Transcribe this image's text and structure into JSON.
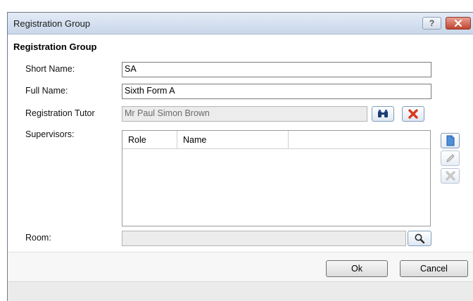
{
  "window": {
    "title": "Registration Group",
    "help_label": "?"
  },
  "form": {
    "group_title": "Registration Group",
    "short_name": {
      "label": "Short Name:",
      "value": "SA"
    },
    "full_name": {
      "label": "Full Name:",
      "value": "Sixth Form A"
    },
    "tutor": {
      "label": "Registration Tutor",
      "value": "Mr Paul Simon Brown"
    },
    "supervisors": {
      "label": "Supervisors:",
      "columns": [
        "Role",
        "Name"
      ],
      "rows": []
    },
    "room": {
      "label": "Room:",
      "value": ""
    }
  },
  "footer": {
    "ok_label": "Ok",
    "cancel_label": "Cancel"
  },
  "colors": {
    "close_red": "#c2432f",
    "delete_red": "#d9381e",
    "titlebar": "#d4e0ef"
  }
}
